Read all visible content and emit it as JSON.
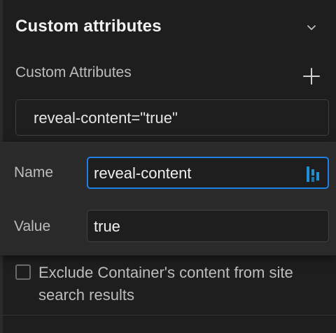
{
  "section": {
    "title": "Custom attributes",
    "chevron_icon": "chevron-down-icon"
  },
  "attributes": {
    "label": "Custom Attributes",
    "add_icon": "plus-icon",
    "items": [
      {
        "display": "reveal-content=\"true\""
      }
    ]
  },
  "editor": {
    "name_label": "Name",
    "name_value": "reveal-content",
    "value_label": "Value",
    "value_value": "true",
    "extension_icon": "password-manager-icon"
  },
  "search": {
    "exclude_label": "Exclude Container's content from site search results",
    "checked": false
  },
  "colors": {
    "background": "#1e1e1e",
    "popover": "#2a2a2a",
    "focus": "#1e7fe6",
    "text": "#e6e6e6",
    "muted": "#bdbdbd"
  }
}
